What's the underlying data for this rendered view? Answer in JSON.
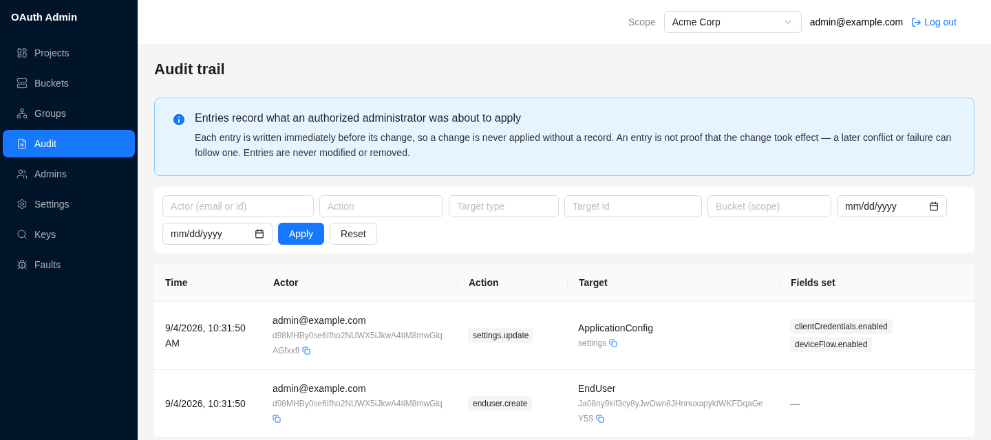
{
  "app_title": "OAuth Admin",
  "nav": [
    {
      "label": "Projects",
      "selected": false
    },
    {
      "label": "Buckets",
      "selected": false
    },
    {
      "label": "Groups",
      "selected": false
    },
    {
      "label": "Audit",
      "selected": true
    },
    {
      "label": "Admins",
      "selected": false
    },
    {
      "label": "Settings",
      "selected": false
    },
    {
      "label": "Keys",
      "selected": false
    },
    {
      "label": "Faults",
      "selected": false
    }
  ],
  "header": {
    "scope_label": "Scope",
    "scope_value": "Acme Corp",
    "user": "admin@example.com",
    "logout": "Log out"
  },
  "page_title": "Audit trail",
  "alert": {
    "title": "Entries record what an authorized administrator was about to apply",
    "body": "Each entry is written immediately before its change, so a change is never applied without a record. An entry is not proof that the change took effect — a later conflict or failure can follow one. Entries are never modified or removed."
  },
  "filters": [
    {
      "kind": "text",
      "placeholder": "Actor (email or id)"
    },
    {
      "kind": "text",
      "placeholder": "Action"
    },
    {
      "kind": "text",
      "placeholder": "Target type"
    },
    {
      "kind": "text",
      "placeholder": "Target id"
    },
    {
      "kind": "text",
      "placeholder": "Bucket (scope)"
    },
    {
      "kind": "date",
      "placeholder": "mm/dd/yyyy"
    },
    {
      "kind": "date",
      "placeholder": "mm/dd/yyyy"
    }
  ],
  "filter_buttons": [
    {
      "label": "Apply",
      "kind": "primary"
    },
    {
      "label": "Reset",
      "kind": "default"
    }
  ],
  "table": {
    "columns": [
      "Time",
      "Actor",
      "Action",
      "Target",
      "Fields set"
    ],
    "rows": [
      {
        "time": "9/4/2026, 10:31:50 AM",
        "actor": "admin@example.com",
        "actor_id": "d98MHBy0se6Ifho2NUWX5iJkwA4tiM8mwGlqAGfxxfI",
        "action": "settings.update",
        "target_type": "ApplicationConfig",
        "target_id": "settings",
        "fields": [
          "clientCredentials.enabled",
          "deviceFlow.enabled"
        ]
      },
      {
        "time": "9/4/2026, 10:31:50",
        "actor": "admin@example.com",
        "actor_id": "d98MHBy0se6Ifho2NUWX5iJkwA4tiM8mwGlq",
        "action": "enduser.create",
        "target_type": "EndUser",
        "target_id": "Ja08ny9kif3cy8yJwOwn8JHnnuxapyktWKFDqaGeY5S",
        "fields": [],
        "fields_empty": "—"
      }
    ]
  }
}
